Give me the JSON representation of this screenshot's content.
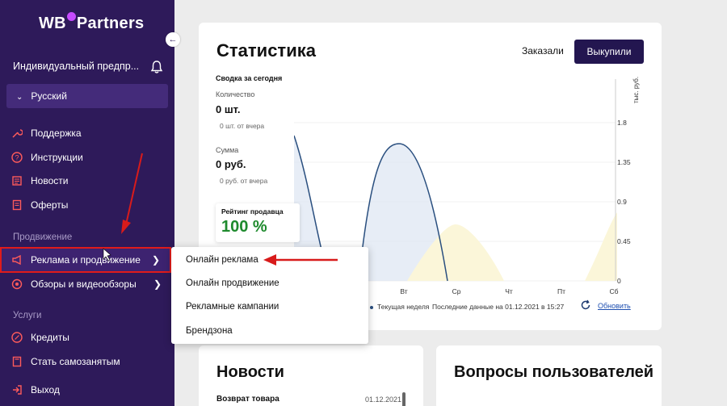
{
  "sidebar": {
    "logo_left": "WB",
    "logo_right": "Partners",
    "org_name": "Индивидуальный предпр...",
    "language": "Русский",
    "items": [
      {
        "label": "Поддержка"
      },
      {
        "label": "Инструкции"
      },
      {
        "label": "Новости"
      },
      {
        "label": "Оферты"
      }
    ],
    "section_promo": "Продвижение",
    "promo_items": [
      {
        "label": "Реклама и продвижение"
      },
      {
        "label": "Обзоры и видеообзоры"
      }
    ],
    "section_services": "Услуги",
    "service_items": [
      {
        "label": "Кредиты"
      },
      {
        "label": "Стать самозанятым"
      },
      {
        "label": "Выход"
      }
    ]
  },
  "stats": {
    "title": "Статистика",
    "tab_ordered": "Заказали",
    "tab_bought": "Выкупили",
    "summary_title": "Сводка за сегодня",
    "qty_label": "Количество",
    "qty_value": "0 шт.",
    "qty_sub": "0 шт. от вчера",
    "sum_label": "Сумма",
    "sum_value": "0 руб.",
    "sum_sub": "0 руб. от вчера",
    "rating_label": "Рейтинг продавца",
    "rating_value": "100 %",
    "legend_current": "Текущая неделя",
    "last_data": "Последние данные на 01.12.2021 в 15:27",
    "refresh": "Обновить",
    "accent_color": "#231650"
  },
  "chart_data": {
    "type": "area",
    "categories": [
      "Вт",
      "Ср",
      "Чт",
      "Пт",
      "Сб"
    ],
    "ylabel": "тыс. руб.",
    "ylim": [
      0,
      1.8
    ],
    "yticks": [
      0,
      0.45,
      0.9,
      1.35,
      1.8
    ],
    "series": [
      {
        "name": "Текущая неделя",
        "color": "#2a4f7f"
      }
    ]
  },
  "dropdown": {
    "items": [
      {
        "label": "Онлайн реклама"
      },
      {
        "label": "Онлайн продвижение"
      },
      {
        "label": "Рекламные кампании"
      },
      {
        "label": "Брендзона"
      }
    ]
  },
  "news": {
    "title": "Новости",
    "item_title": "Возврат товара",
    "item_date": "01.12.2021"
  },
  "questions": {
    "title": "Вопросы пользователей"
  }
}
